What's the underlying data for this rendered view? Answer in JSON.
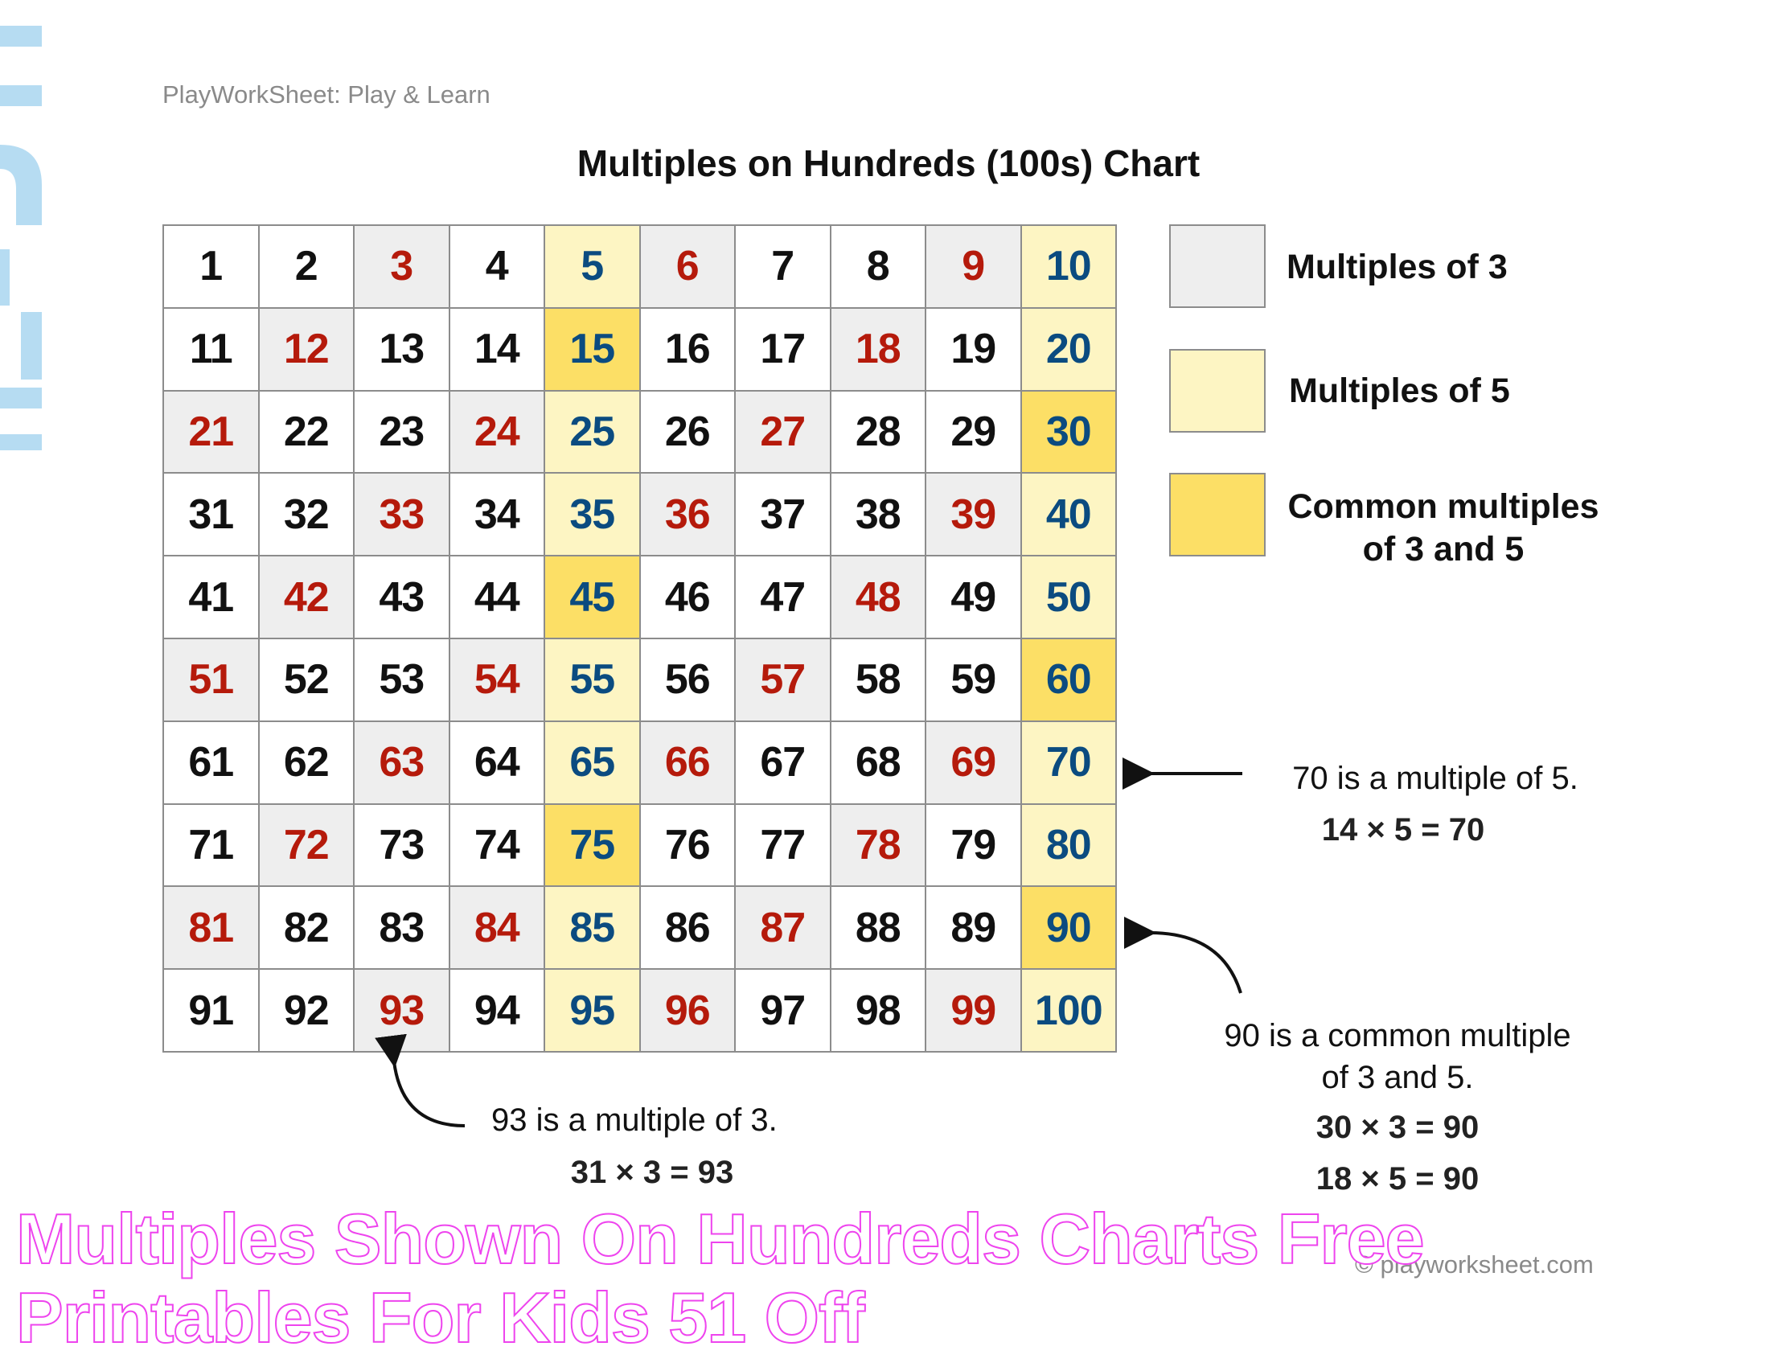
{
  "header": {
    "brand": "PlayWorkSheet: Play & Learn",
    "title": "Multiples on Hundreds (100s) Chart"
  },
  "grid": {
    "numbers": [
      1,
      2,
      3,
      4,
      5,
      6,
      7,
      8,
      9,
      10,
      11,
      12,
      13,
      14,
      15,
      16,
      17,
      18,
      19,
      20,
      21,
      22,
      23,
      24,
      25,
      26,
      27,
      28,
      29,
      30,
      31,
      32,
      33,
      34,
      35,
      36,
      37,
      38,
      39,
      40,
      41,
      42,
      43,
      44,
      45,
      46,
      47,
      48,
      49,
      50,
      51,
      52,
      53,
      54,
      55,
      56,
      57,
      58,
      59,
      60,
      61,
      62,
      63,
      64,
      65,
      66,
      67,
      68,
      69,
      70,
      71,
      72,
      73,
      74,
      75,
      76,
      77,
      78,
      79,
      80,
      81,
      82,
      83,
      84,
      85,
      86,
      87,
      88,
      89,
      90,
      91,
      92,
      93,
      94,
      95,
      96,
      97,
      98,
      99,
      100
    ],
    "colors": {
      "multiple_of_3_fill": "#eeeeee",
      "multiple_of_3_text": "#b51a0b",
      "multiple_of_5_fill": "#fdf5c3",
      "multiple_of_5_text": "#0b4b80",
      "common_fill": "#fcdf66"
    }
  },
  "legend": {
    "items": [
      {
        "label": "Multiples of 3"
      },
      {
        "label": "Multiples of 5"
      },
      {
        "label_line1": "Common multiples",
        "label_line2": "of 3 and 5"
      }
    ]
  },
  "annotations": {
    "seventy": {
      "text": "70 is a multiple of 5.",
      "equation": "14 × 5 = 70"
    },
    "ninety": {
      "line1": "90 is a common multiple",
      "line2": "of 3 and 5.",
      "equation1": "30 × 3 = 90",
      "equation2": "18 × 5 = 90"
    },
    "ninety_three": {
      "text": "93 is a multiple of 3.",
      "equation": "31 × 3 = 93"
    }
  },
  "footer": {
    "copyright": "© playworksheet.com"
  },
  "watermark": {
    "line1": "Multiples Shown On Hundreds Charts Free",
    "line2": "Printables For Kids 51 Off"
  }
}
